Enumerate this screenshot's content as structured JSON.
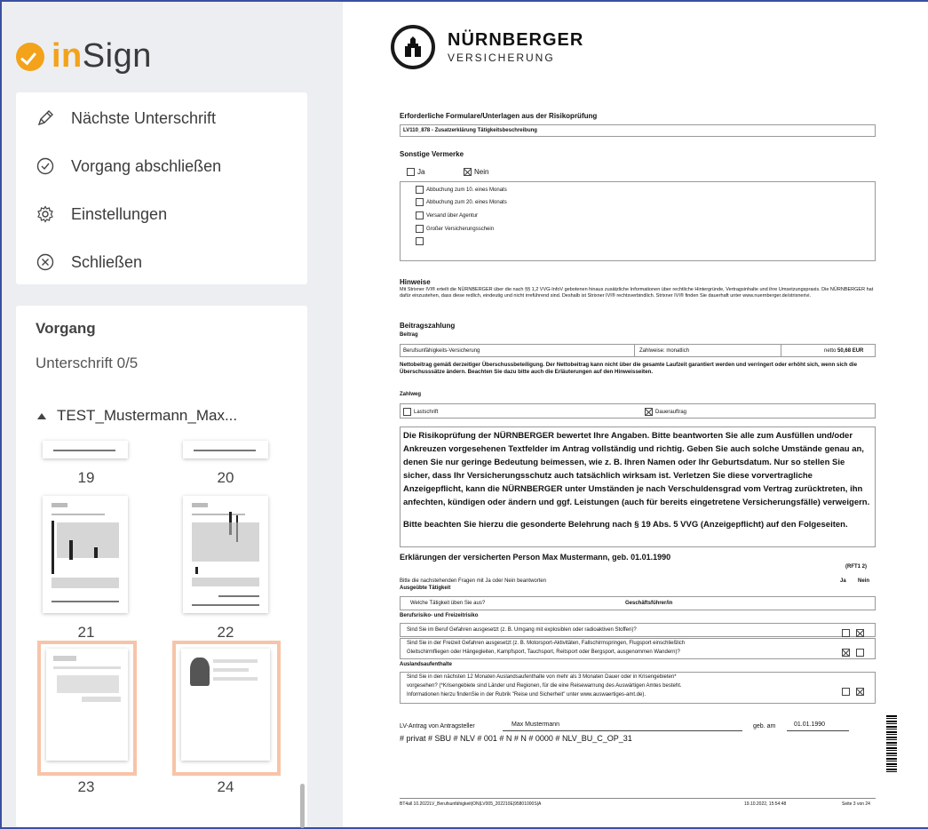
{
  "sidebar": {
    "logo": {
      "part1": "in",
      "part2": "Sign"
    },
    "menu": [
      {
        "label": "Nächste Unterschrift",
        "icon": "pen-icon"
      },
      {
        "label": "Vorgang abschließen",
        "icon": "check-circle-icon"
      },
      {
        "label": "Einstellungen",
        "icon": "gear-icon"
      },
      {
        "label": "Schließen",
        "icon": "close-circle-icon"
      }
    ],
    "process": {
      "title": "Vorgang",
      "signature_status": "Unterschrift 0/5",
      "document_name": "TEST_Mustermann_Max...",
      "pages": [
        "19",
        "20",
        "21",
        "22",
        "23",
        "24"
      ],
      "selected_pages": [
        "23",
        "24"
      ]
    }
  },
  "document": {
    "brand": {
      "name": "NÜRNBERGER",
      "sub": "VERSICHERUNG"
    },
    "forms_heading": "Erforderliche Formulare/Unterlagen aus der Risikoprüfung",
    "forms_item": "LV110_878 - Zusatzerklärung Tätigkeitsbeschreibung",
    "other_heading": "Sonstige Vermerke",
    "ja": "Ja",
    "nein": "Nein",
    "options": [
      "Abbuchung zum 10. eines Monats",
      "Abbuchung zum 20. eines Monats",
      "Versand über Agentur",
      "Großer Versicherungsschein",
      ""
    ],
    "hints_heading": "Hinweise",
    "hints_text": "Mit Strixner IVI® erteilt die NÜRNBERGER über die nach §§ 1,2 VVG-InfoV gebotenen hinaus zusätzliche Informationen über rechtliche Hintergründe, Vertragsinhalte und ihre Umsetzungspraxis. Die NÜRNBERGER hat dafür einzustehen, dass diese redlich, eindeutig und nicht irreführend sind. Deshalb ist Strixner IVI® rechtsverbindlich. Strixner IVI® finden Sie dauerhaft unter www.nuernberger.de/strixnerivi.",
    "payment_heading": "Beitragszahlung",
    "premium_label": "Beitrag",
    "premium_product": "Berufsunfähigkeits-Versicherung",
    "premium_mode": "Zahlweise: monatlich",
    "premium_amount_prefix": "netto",
    "premium_amount": "50,68 EUR",
    "net_note": "Nettobeitrag gemäß derzeitiger Überschussbeteiligung. Der Nettobeitrag kann nicht über die gesamte Laufzeit garantiert werden und verringert oder erhöht sich, wenn sich die Überschusssätze ändern. Beachten Sie dazu bitte auch die Erläuterungen auf den Hinweisseiten.",
    "payment_method_label": "Zahlweg",
    "payment_method_1": "Lastschrift",
    "payment_method_2": "Dauerauftrag",
    "risk_text": "Die Risikoprüfung der NÜRNBERGER bewertet Ihre Angaben. Bitte beantworten Sie alle zum Ausfüllen und/oder Ankreuzen vorgesehenen Textfelder im Antrag vollständig und richtig. Geben Sie auch solche Umstände genau an, denen Sie nur geringe Bedeutung beimessen, wie z. B. Ihren Namen oder Ihr Geburtsdatum. Nur so stellen Sie sicher, dass Ihr Versicherungsschutz auch tatsächlich wirksam ist. Verletzen Sie diese vorvertragliche Anzeigepflicht, kann die NÜRNBERGER unter Umständen je nach Verschuldensgrad vom Vertrag zurücktreten, ihn anfechten, kündigen oder ändern und ggf. Leistungen (auch für bereits eingetretene Versicherungsfälle) verweigern.",
    "risk_note": "Bitte beachten Sie hierzu die gesonderte Belehrung nach § 19 Abs. 5 VVG (Anzeigepflicht) auf den Folgeseiten.",
    "declaration_heading": "Erklärungen der versicherten Person Max Mustermann, geb. 01.01.1990",
    "rft": "(RFT1 2)",
    "question_intro": "Bitte die nachstehenden Fragen mit Ja oder Nein beantworten",
    "col_ja": "Ja",
    "col_nein": "Nein",
    "occupation_heading": "Ausgeübte Tätigkeit",
    "occupation_q": "Welche Tätigkeit üben Sie aus?",
    "occupation_a": "Geschäftsführer/in",
    "risk_heading": "Berufsrisiko- und Freizeitrisiko",
    "q1": "Sind Sie im Beruf Gefahren ausgesetzt (z. B. Umgang mit explosiblen oder radioaktiven Stoffen)?",
    "q2_line1": "Sind Sie in der Freizeit Gefahren ausgesetzt (z. B. Motorsport-Aktivitäten, Fallschirmspringen, Flugsport einschließlich",
    "q2_line2": "Gleitschirmfliegen oder Hängegleiten, Kampfsport, Tauchsport, Reitsport oder Bergsport, ausgenommen Wandern)?",
    "abroad_heading": "Auslandsaufenthalte",
    "q3_line1": "Sind Sie in den nächsten 12 Monaten Auslandsaufenthalte von mehr als 3 Monaten Dauer oder in Krisengebieten*",
    "q3_line2": "vorgesehen? (*Krisengebiete sind Länder und Regionen, für die eine Reisewarnung des Auswärtigen Amtes besteht.",
    "q3_line3": "Informationen hierzu findenSie in der Rubrik \"Reise und Sicherheit\" unter www.auswaertiges-amt.de).",
    "applicant_label": "LV-Antrag von Antragsteller",
    "applicant_name": "Max Mustermann",
    "dob_label": "geb. am",
    "dob_value": "01.01.1990",
    "code_line": "# privat # SBU # NLV # 001 # N # N # 0000 # NLV_BU_C_OP_31",
    "footer_left": "BT4all 10.2022LV_Berufsunfähigkeit|ON|LV005_202210E|95801000S|A",
    "footer_date": "19.10.2022, 15:54:48",
    "footer_page": "Seite 3 von 24"
  }
}
